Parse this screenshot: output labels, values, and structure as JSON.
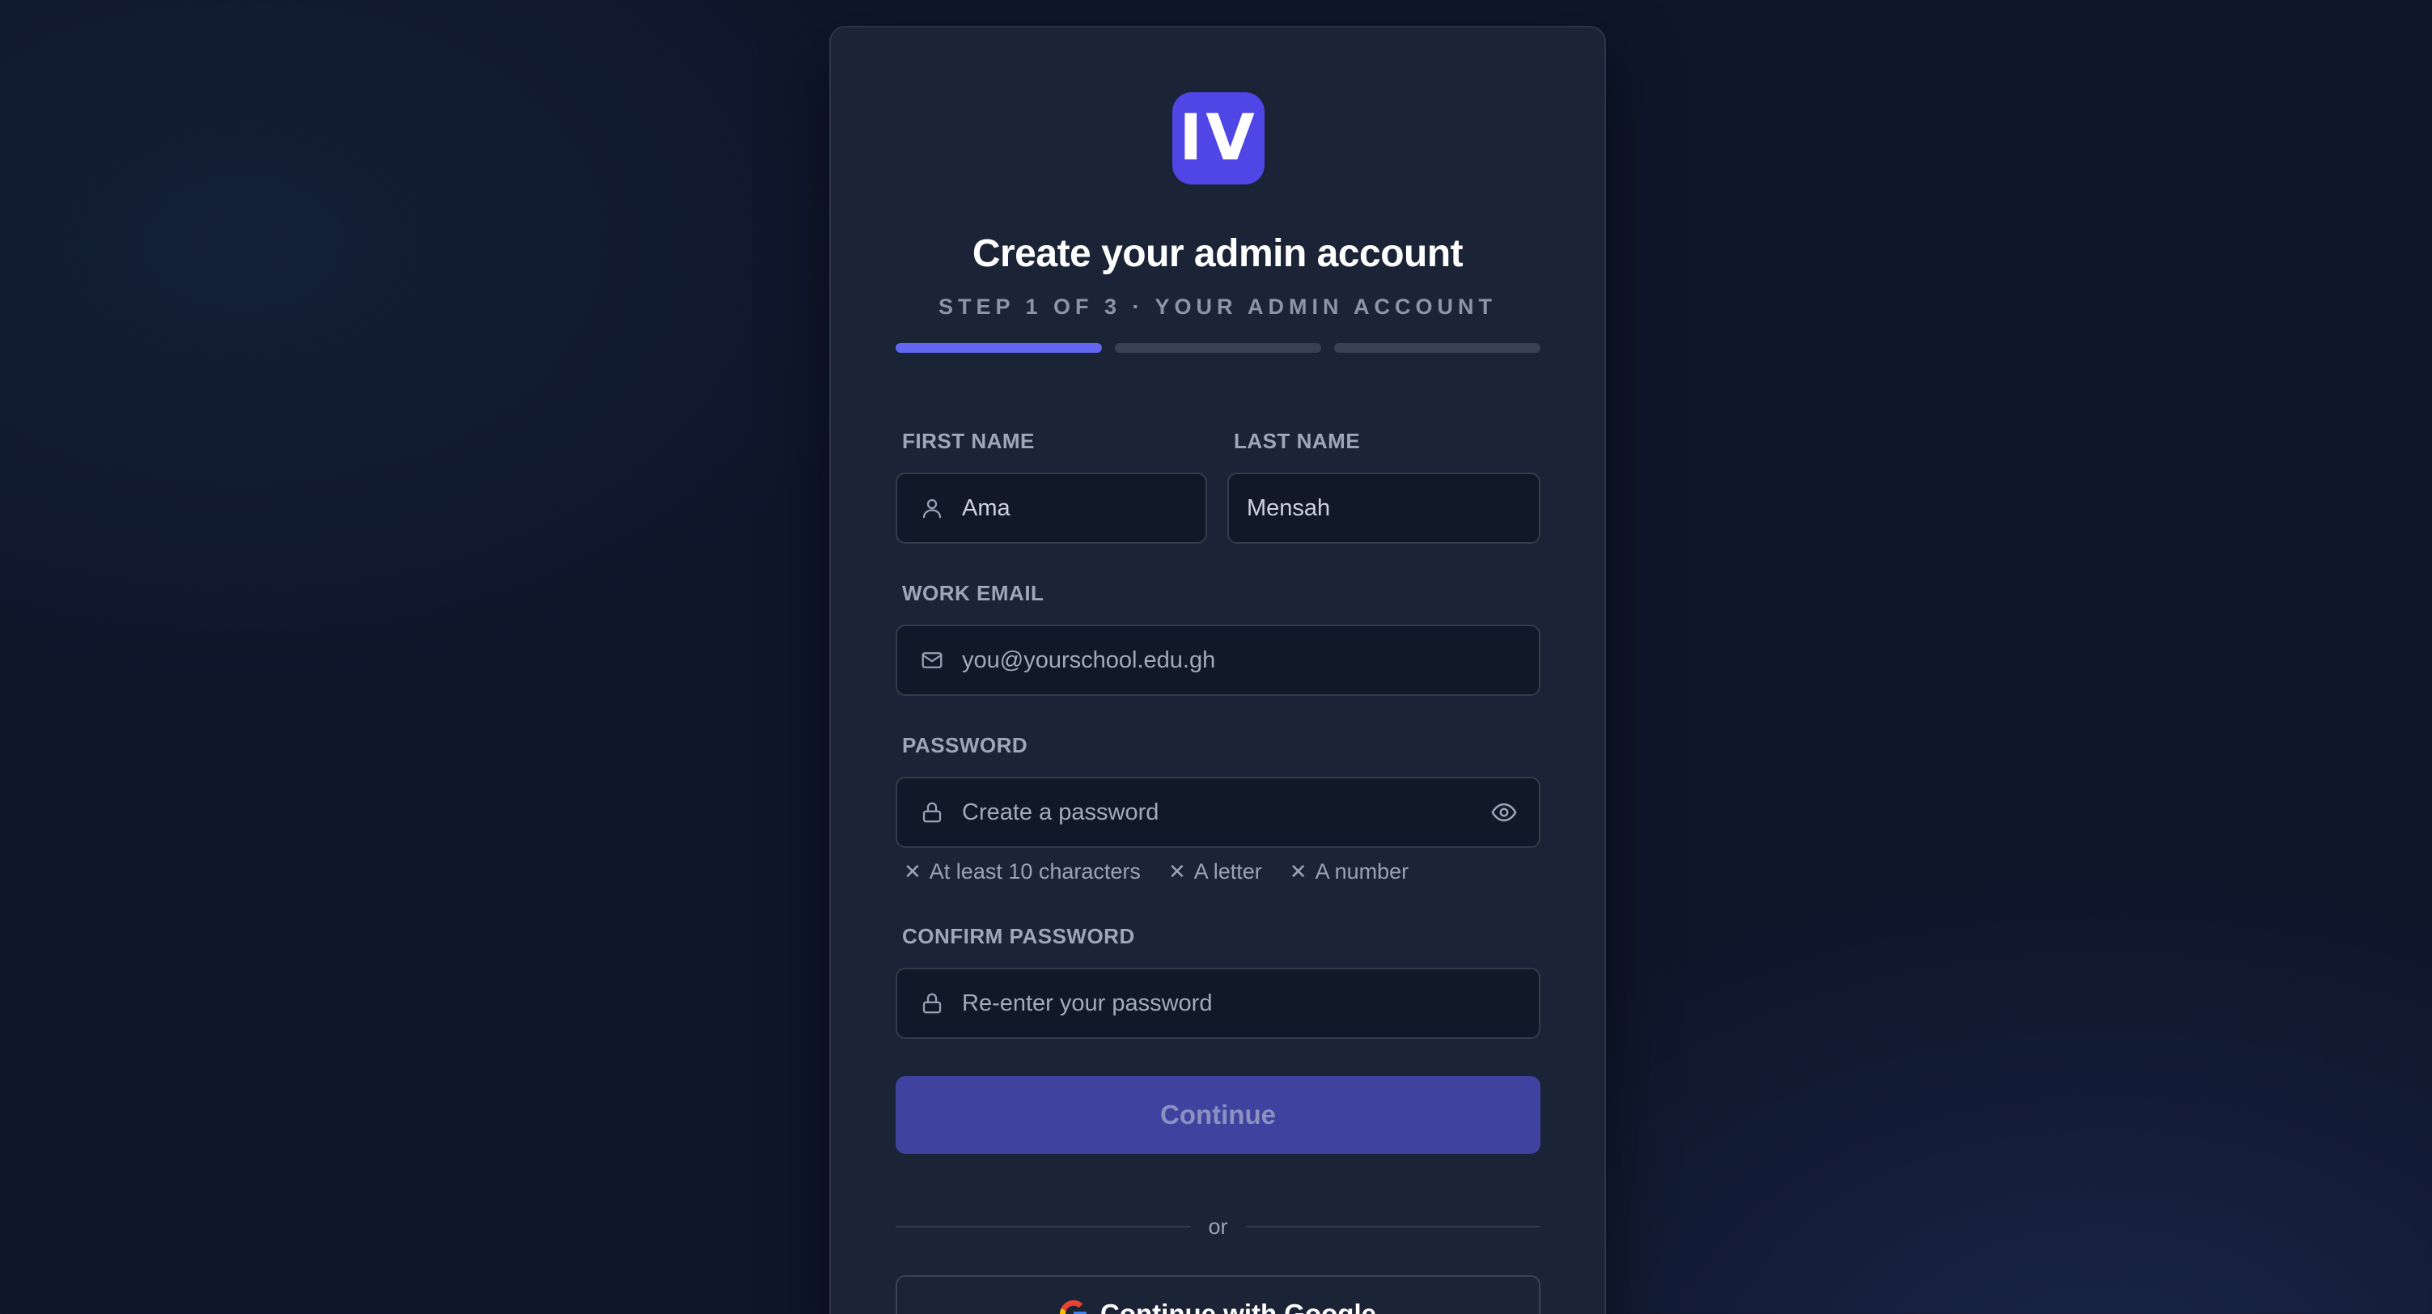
{
  "logo": {
    "text": "IV",
    "color": "#4f46e5"
  },
  "title": "Create your admin account",
  "subtitle": "STEP 1 OF 3 · YOUR ADMIN ACCOUNT",
  "progress": {
    "current_step": 1,
    "total_steps": 3,
    "active_color": "#6366f1"
  },
  "form": {
    "first_name": {
      "label": "FIRST NAME",
      "value": "Ama",
      "icon": "user-icon"
    },
    "last_name": {
      "label": "LAST NAME",
      "value": "Mensah"
    },
    "email": {
      "label": "WORK EMAIL",
      "placeholder": "you@yourschool.edu.gh",
      "icon": "mail-icon"
    },
    "password": {
      "label": "PASSWORD",
      "placeholder": "Create a password",
      "icon": "lock-icon",
      "toggle_icon": "eye-icon"
    },
    "requirements": [
      {
        "text": "At least 10 characters",
        "met": false
      },
      {
        "text": "A letter",
        "met": false
      },
      {
        "text": "A number",
        "met": false
      }
    ],
    "confirm_password": {
      "label": "CONFIRM PASSWORD",
      "placeholder": "Re-enter your password",
      "icon": "lock-icon"
    }
  },
  "actions": {
    "continue_label": "Continue",
    "divider_text": "or",
    "google_label": "Continue with Google"
  }
}
